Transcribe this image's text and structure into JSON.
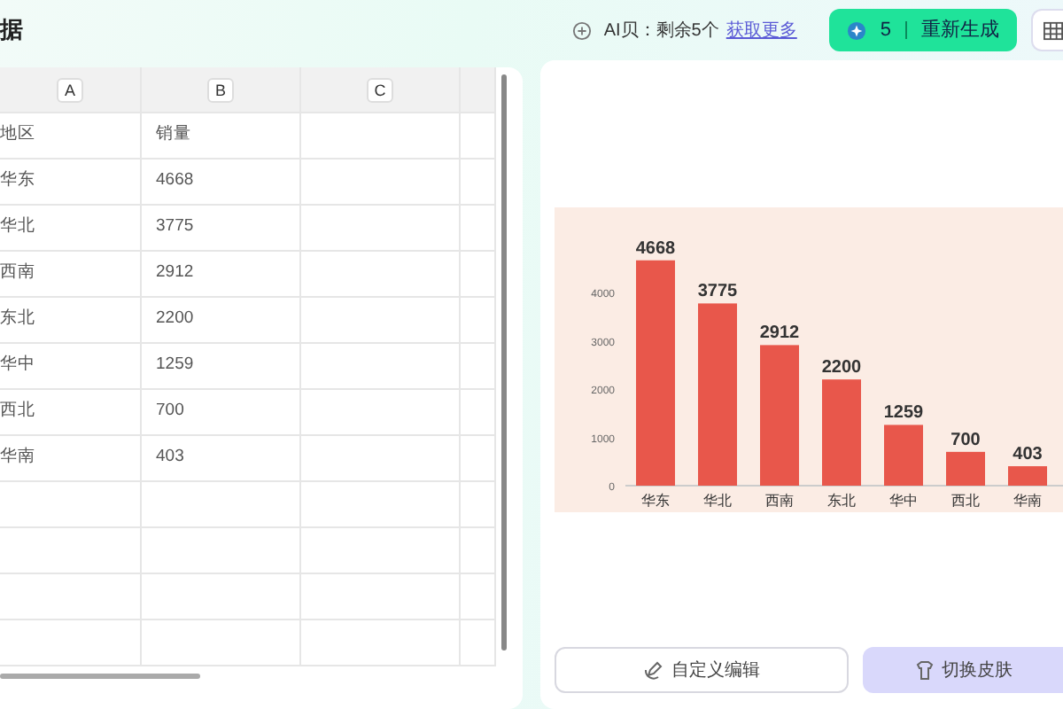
{
  "header": {
    "title": "据",
    "credits": "AI贝：剩余5个",
    "credits_link": "获取更多",
    "regen_count": "5",
    "regen_label": "重新生成"
  },
  "sheet": {
    "columns": [
      "A",
      "B",
      "C"
    ],
    "rows": [
      [
        "地区",
        "销量"
      ],
      [
        "华东",
        "4668"
      ],
      [
        "华北",
        "3775"
      ],
      [
        "西南",
        "2912"
      ],
      [
        "东北",
        "2200"
      ],
      [
        "华中",
        "1259"
      ],
      [
        "西北",
        "700"
      ],
      [
        "华南",
        "403"
      ]
    ]
  },
  "chart": {
    "chart_data": {
      "type": "bar",
      "categories": [
        "华东",
        "华北",
        "西南",
        "东北",
        "华中",
        "西北",
        "华南"
      ],
      "series": [
        {
          "color": "#e8574b",
          "values": [
            4668,
            3775,
            2912,
            2200,
            1259,
            700,
            403
          ]
        }
      ],
      "ylim": [
        0,
        4700
      ],
      "yticks": [
        0,
        1000,
        2000,
        3000,
        4000
      ],
      "data_labels": true
    }
  },
  "buttons": [
    {
      "label": "自定义编辑",
      "kind": "outline"
    },
    {
      "label": "切换皮肤",
      "kind": "soft"
    }
  ]
}
